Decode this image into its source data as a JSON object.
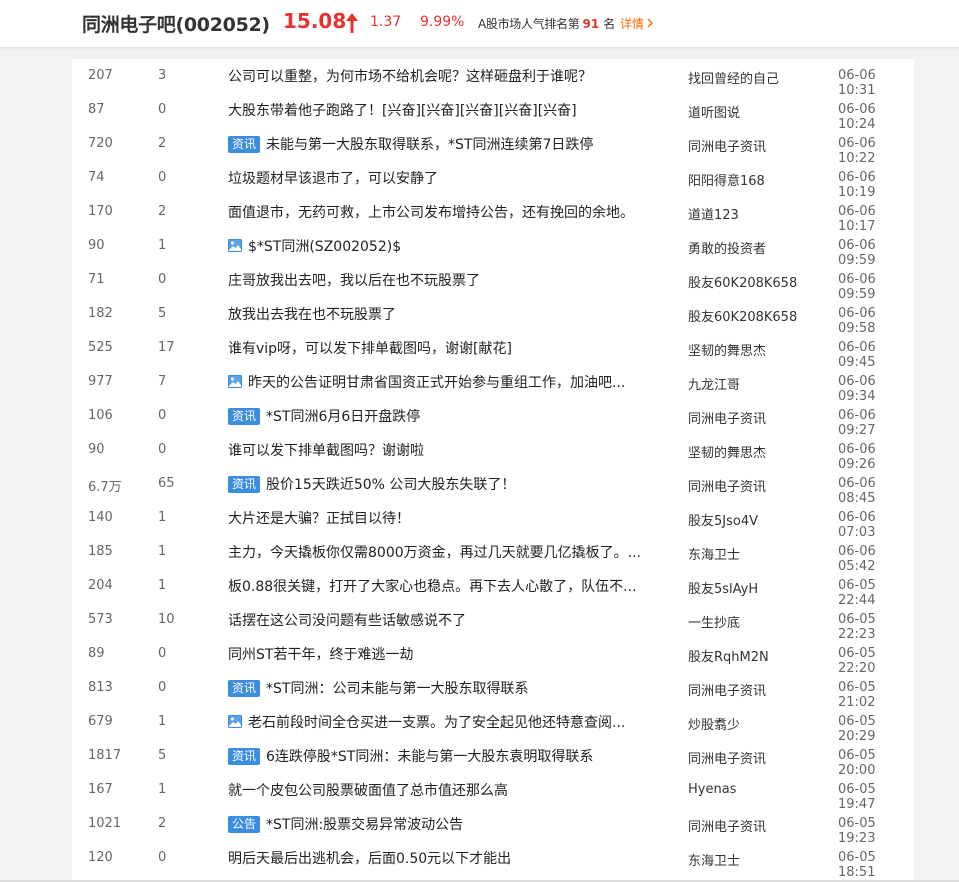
{
  "header": {
    "bar_title": "同洲电子吧(002052)",
    "price": "15.08",
    "change_abs": "1.37",
    "change_pct": "9.99%",
    "rank_prefix": "A股市场人气排名第",
    "rank_number": "91",
    "rank_suffix": "名",
    "detail_label": "详情",
    "detail_icon": "chevron-right-icon",
    "up_color": "#e8322e"
  },
  "colors": {
    "tag_bg": "#3b8de1",
    "link_color": "#ff6600"
  },
  "posts": [
    {
      "reads": "207",
      "replies": "3",
      "tag": "",
      "has_image": false,
      "title": "公司可以重整，为何市场不给机会呢？这样砸盘利于谁呢？",
      "author": "找回曾经的自己",
      "time": "06-06 10:31"
    },
    {
      "reads": "87",
      "replies": "0",
      "tag": "",
      "has_image": false,
      "title": "大股东带着他子跑路了！[兴奋][兴奋][兴奋][兴奋][兴奋]",
      "author": "道听图说",
      "time": "06-06 10:24"
    },
    {
      "reads": "720",
      "replies": "2",
      "tag": "资讯",
      "has_image": false,
      "title": "未能与第一大股东取得联系，*ST同洲连续第7日跌停",
      "author": "同洲电子资讯",
      "time": "06-06 10:22"
    },
    {
      "reads": "74",
      "replies": "0",
      "tag": "",
      "has_image": false,
      "title": "垃圾题材早该退市了，可以安静了",
      "author": "阳阳得意168",
      "time": "06-06 10:19"
    },
    {
      "reads": "170",
      "replies": "2",
      "tag": "",
      "has_image": false,
      "title": "面值退市，无药可救，上市公司发布增持公告，还有挽回的余地。",
      "author": "道道123",
      "time": "06-06 10:17"
    },
    {
      "reads": "90",
      "replies": "1",
      "tag": "",
      "has_image": true,
      "title": "$*ST同洲(SZ002052)$",
      "author": "勇敢的投资者",
      "time": "06-06 09:59"
    },
    {
      "reads": "71",
      "replies": "0",
      "tag": "",
      "has_image": false,
      "title": "庄哥放我出去吧，我以后在也不玩股票了",
      "author": "股友60K208K658",
      "time": "06-06 09:59"
    },
    {
      "reads": "182",
      "replies": "5",
      "tag": "",
      "has_image": false,
      "title": "放我出去我在也不玩股票了",
      "author": "股友60K208K658",
      "time": "06-06 09:58"
    },
    {
      "reads": "525",
      "replies": "17",
      "tag": "",
      "has_image": false,
      "title": "谁有vip呀，可以发下排单截图吗，谢谢[献花]",
      "author": "坚韧的舞思杰",
      "time": "06-06 09:45"
    },
    {
      "reads": "977",
      "replies": "7",
      "tag": "",
      "has_image": true,
      "title": "昨天的公告证明甘肃省国资正式开始参与重组工作，加油吧...",
      "author": "九龙江哥",
      "time": "06-06 09:34"
    },
    {
      "reads": "106",
      "replies": "0",
      "tag": "资讯",
      "has_image": false,
      "title": "*ST同洲6月6日开盘跌停",
      "author": "同洲电子资讯",
      "time": "06-06 09:27"
    },
    {
      "reads": "90",
      "replies": "0",
      "tag": "",
      "has_image": false,
      "title": "谁可以发下排单截图吗？谢谢啦",
      "author": "坚韧的舞思杰",
      "time": "06-06 09:26"
    },
    {
      "reads": "6.7万",
      "replies": "65",
      "tag": "资讯",
      "has_image": false,
      "title": "股价15天跌近50% 公司大股东失联了！",
      "author": "同洲电子资讯",
      "time": "06-06 08:45"
    },
    {
      "reads": "140",
      "replies": "1",
      "tag": "",
      "has_image": false,
      "title": "大片还是大骗？正拭目以待！",
      "author": "股友5Jso4V",
      "time": "06-06 07:03"
    },
    {
      "reads": "185",
      "replies": "1",
      "tag": "",
      "has_image": false,
      "title": "主力，今天撬板你仅需8000万资金，再过几天就要几亿撬板了。...",
      "author": "东海卫士",
      "time": "06-06 05:42"
    },
    {
      "reads": "204",
      "replies": "1",
      "tag": "",
      "has_image": false,
      "title": "板0.88很关键，打开了大家心也稳点。再下去人心散了，队伍不...",
      "author": "股友5slAyH",
      "time": "06-05 22:44"
    },
    {
      "reads": "573",
      "replies": "10",
      "tag": "",
      "has_image": false,
      "title": "话摆在这公司没问题有些话敏感说不了",
      "author": "一生抄底",
      "time": "06-05 22:23"
    },
    {
      "reads": "89",
      "replies": "0",
      "tag": "",
      "has_image": false,
      "title": "同州ST若干年，终于难逃一劫",
      "author": "股友RqhM2N",
      "time": "06-05 22:20"
    },
    {
      "reads": "813",
      "replies": "0",
      "tag": "资讯",
      "has_image": false,
      "title": "*ST同洲：公司未能与第一大股东取得联系",
      "author": "同洲电子资讯",
      "time": "06-05 21:02"
    },
    {
      "reads": "679",
      "replies": "1",
      "tag": "",
      "has_image": true,
      "title": "老石前段时间全仓买进一支票。为了安全起见他还特意查阅...",
      "author": "炒股翥少",
      "time": "06-05 20:29"
    },
    {
      "reads": "1817",
      "replies": "5",
      "tag": "资讯",
      "has_image": false,
      "title": "6连跌停股*ST同洲：未能与第一大股东袁明取得联系",
      "author": "同洲电子资讯",
      "time": "06-05 20:00"
    },
    {
      "reads": "167",
      "replies": "1",
      "tag": "",
      "has_image": false,
      "title": "就一个皮包公司股票破面值了总市值还那么高",
      "author": "Hyenas",
      "time": "06-05 19:47"
    },
    {
      "reads": "1021",
      "replies": "2",
      "tag": "公告",
      "has_image": false,
      "title": "*ST同洲:股票交易异常波动公告",
      "author": "同洲电子资讯",
      "time": "06-05 19:23"
    },
    {
      "reads": "120",
      "replies": "0",
      "tag": "",
      "has_image": false,
      "title": "明后天最后出逃机会，后面0.50元以下才能出",
      "author": "东海卫士",
      "time": "06-05 18:51"
    }
  ]
}
